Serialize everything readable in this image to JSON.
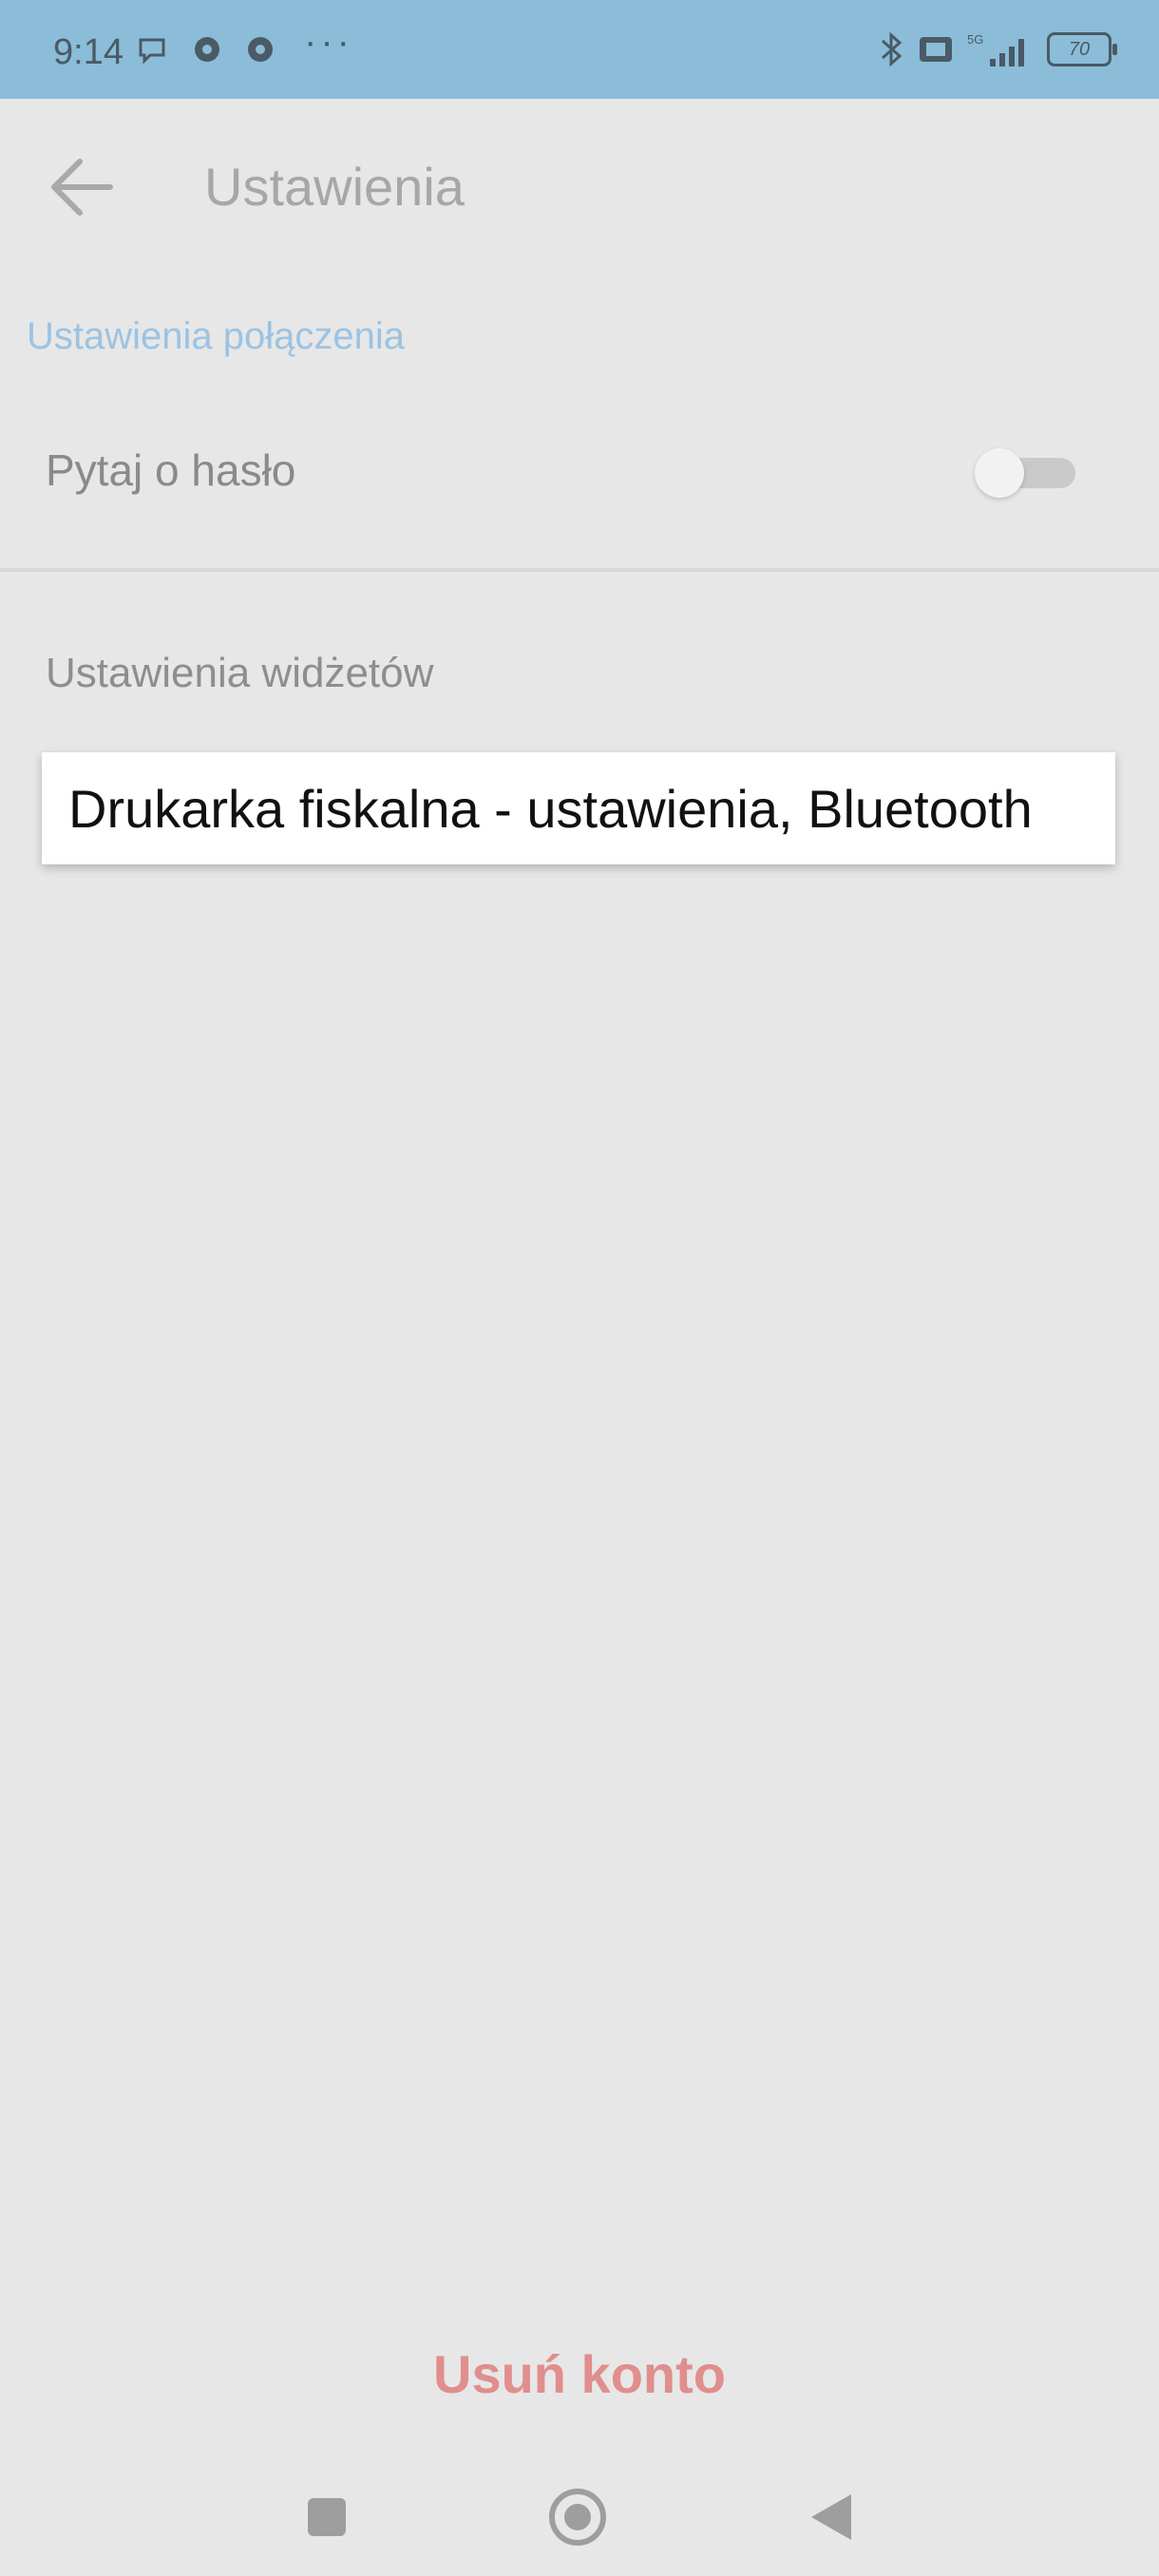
{
  "status_bar": {
    "time": "9:14",
    "icons": [
      "chat-bubble-icon",
      "app-notification-icon",
      "app-notification-icon",
      "more-dots-icon",
      "bluetooth-icon",
      "nfc-icon",
      "5g-signal-icon"
    ],
    "more": "···",
    "battery": "70"
  },
  "app_bar": {
    "title": "Ustawienia",
    "back_icon": "arrow-left-icon"
  },
  "connection_section": {
    "header": "Ustawienia połączenia",
    "ask_password_label": "Pytaj o hasło",
    "ask_password_enabled": false
  },
  "widgets_section": {
    "header": "Ustawienia widżetów"
  },
  "tooltip": {
    "text": "Drukarka fiskalna - ustawienia, Bluetooth"
  },
  "delete_account": {
    "label": "Usuń konto"
  },
  "nav_bar": {
    "buttons": [
      "recents-square-icon",
      "home-circle-icon",
      "back-triangle-icon"
    ]
  },
  "colors": {
    "status_bar": "#8bbdd8",
    "background": "#e7e7e7",
    "accent": "#9cc3e2",
    "danger": "#e08e8e"
  }
}
